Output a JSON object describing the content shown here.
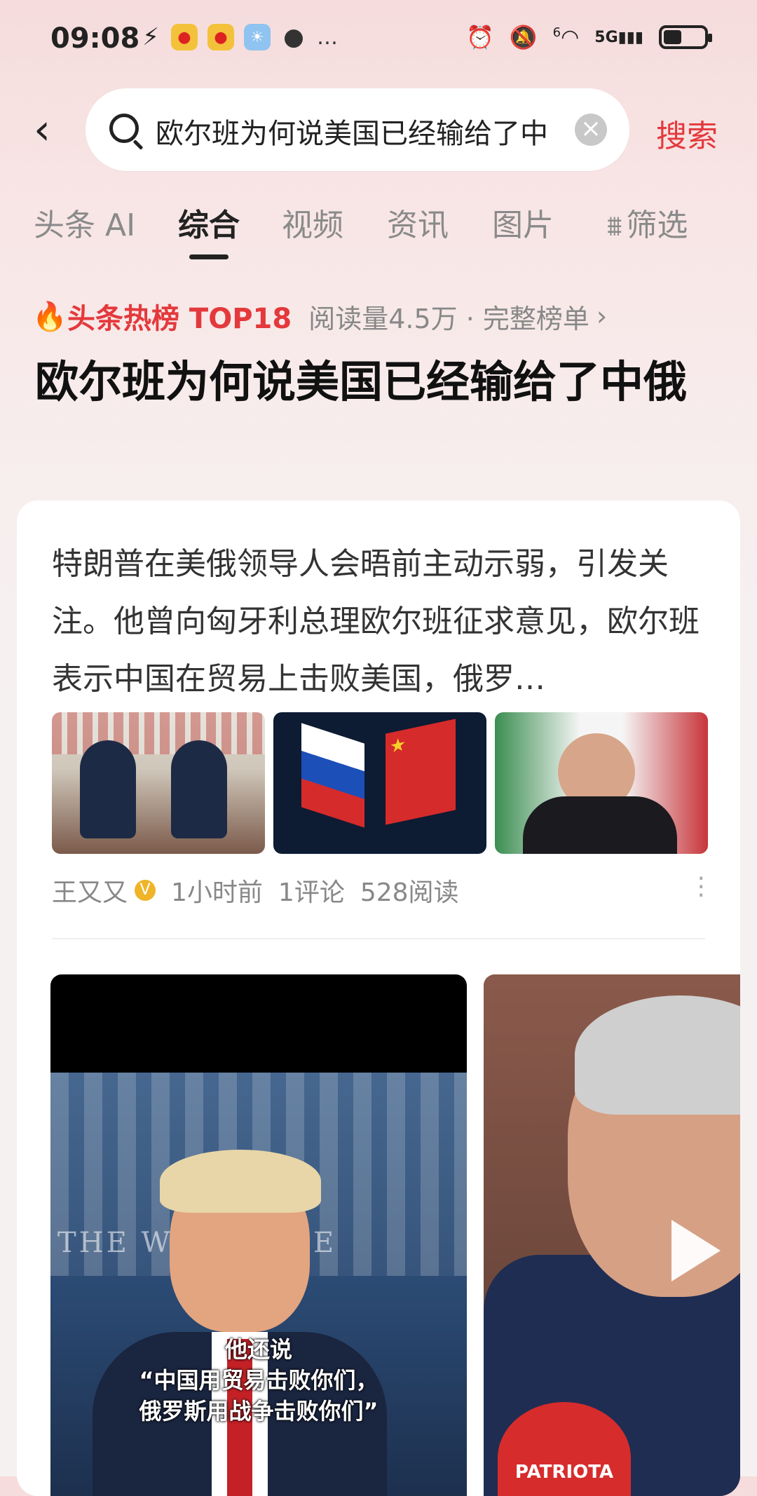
{
  "status_bar": {
    "time": "09:08",
    "network": "5G",
    "sim_slot": "6"
  },
  "search": {
    "query": "欧尔班为何说美国已经输给了中俄",
    "submit_label": "搜索"
  },
  "tabs": [
    {
      "label": "头条 AI",
      "active": false
    },
    {
      "label": "综合",
      "active": true
    },
    {
      "label": "视频",
      "active": false
    },
    {
      "label": "资讯",
      "active": false
    },
    {
      "label": "图片",
      "active": false
    },
    {
      "label": "筛选",
      "active": false
    }
  ],
  "hot": {
    "label": "头条热榜 TOP18",
    "meta": "阅读量4.5万 · 完整榜单",
    "chevron": "›"
  },
  "headline": "欧尔班为何说美国已经输给了中俄",
  "article": {
    "summary": "特朗普在美俄领导人会晤前主动示弱，引发关注。他曾向匈牙利总理欧尔班征求意见，欧尔班表示中国在贸易上击败美国，俄罗…",
    "author": "王又又",
    "time": "1小时前",
    "comments": "1评论",
    "reads": "528阅读"
  },
  "video1": {
    "bg_text": "THE WH   HOUSE",
    "caption_line1": "他还说",
    "caption_line2": "“中国用贸易击败你们，",
    "caption_line3": "俄罗斯用战争击败你们”"
  },
  "video2": {
    "mic_text": "PATRIOTA"
  },
  "colors": {
    "accent": "#e4393c",
    "text_primary": "#222222",
    "text_muted": "#888888"
  }
}
